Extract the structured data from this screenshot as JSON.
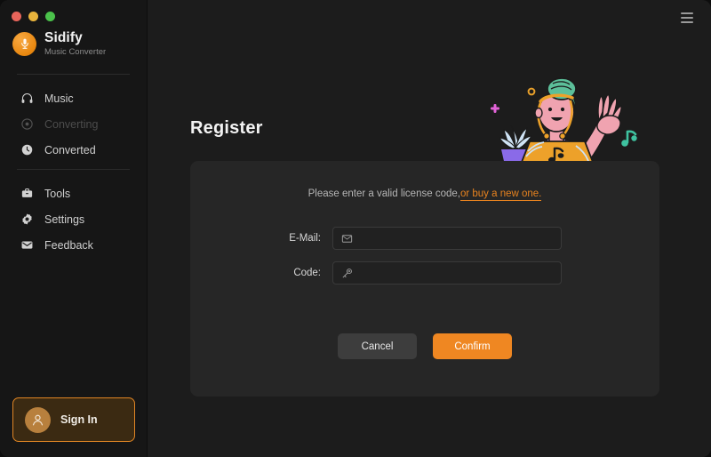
{
  "window": {
    "traffic_lights": [
      "close",
      "minimize",
      "maximize"
    ],
    "menu_icon": "hamburger-menu-icon"
  },
  "sidebar": {
    "brand": {
      "name": "Sidify",
      "subtitle": "Music Converter",
      "logo_icon": "microphone-logo-icon",
      "logo_color": "#e8870f"
    },
    "groups": [
      {
        "items": [
          {
            "label": "Music",
            "icon": "headphones-icon",
            "state": "normal"
          },
          {
            "label": "Converting",
            "icon": "converting-spinner-icon",
            "state": "disabled"
          },
          {
            "label": "Converted",
            "icon": "clock-icon",
            "state": "normal"
          }
        ]
      },
      {
        "items": [
          {
            "label": "Tools",
            "icon": "toolbox-icon",
            "state": "normal"
          },
          {
            "label": "Settings",
            "icon": "gear-icon",
            "state": "normal"
          },
          {
            "label": "Feedback",
            "icon": "envelope-icon",
            "state": "normal"
          }
        ]
      }
    ],
    "signin": {
      "label": "Sign In",
      "avatar_icon": "user-avatar-icon",
      "border_color": "#e08524",
      "fill_color": "#3b2a12"
    }
  },
  "main": {
    "page_title": "Register",
    "illustration": {
      "name": "person-waving-with-laptop-illustration",
      "colors": {
        "hat": "#5cbf9a",
        "skin": "#f0a3b0",
        "shirt": "#7d5ce0",
        "laptop": "#eda12a",
        "plant": "#cfe3f5",
        "pot": "#8a6ae8",
        "note": "#3fc2a0",
        "plus": "#e263d8",
        "circle": "#e8a02a"
      }
    },
    "card": {
      "message_text": "Please enter a valid license code,",
      "message_link": "or buy a new one.",
      "link_color": "#e8831f",
      "fields": [
        {
          "label": "E-Mail:",
          "icon": "envelope-icon",
          "value": "",
          "placeholder": ""
        },
        {
          "label": "Code:",
          "icon": "key-icon",
          "value": "",
          "placeholder": ""
        }
      ],
      "buttons": {
        "cancel_label": "Cancel",
        "confirm_label": "Confirm",
        "confirm_color": "#ef8722",
        "cancel_color": "#3d3d3d"
      }
    }
  }
}
